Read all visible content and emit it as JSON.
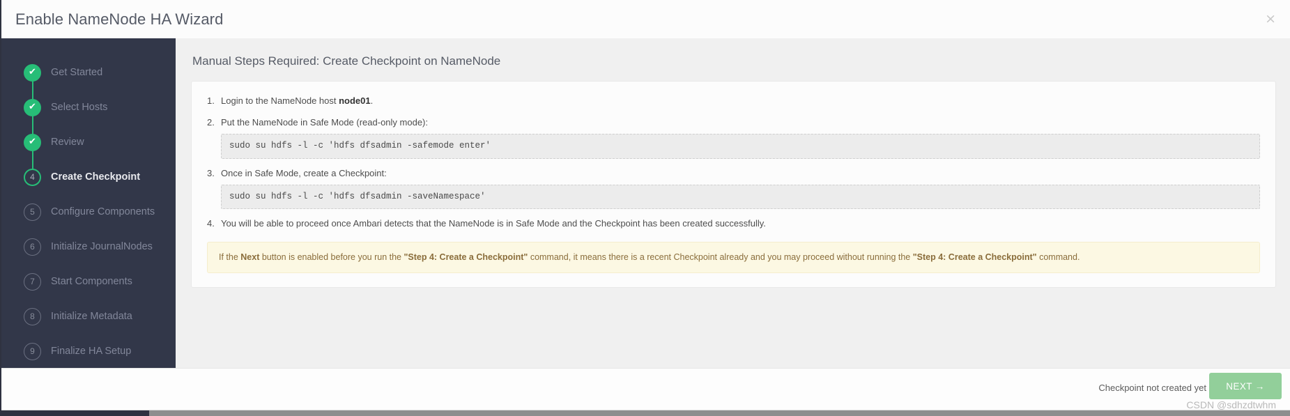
{
  "window": {
    "title": "Enable NameNode HA Wizard",
    "close_icon": "×"
  },
  "sidebar": {
    "steps": [
      {
        "number": "1",
        "label": "Get Started",
        "state": "done",
        "mark": "✔"
      },
      {
        "number": "2",
        "label": "Select Hosts",
        "state": "done",
        "mark": "✔"
      },
      {
        "number": "3",
        "label": "Review",
        "state": "done",
        "mark": "✔"
      },
      {
        "number": "4",
        "label": "Create Checkpoint",
        "state": "current",
        "mark": "4"
      },
      {
        "number": "5",
        "label": "Configure Components",
        "state": "pending",
        "mark": "5"
      },
      {
        "number": "6",
        "label": "Initialize JournalNodes",
        "state": "pending",
        "mark": "6"
      },
      {
        "number": "7",
        "label": "Start Components",
        "state": "pending",
        "mark": "7"
      },
      {
        "number": "8",
        "label": "Initialize Metadata",
        "state": "pending",
        "mark": "8"
      },
      {
        "number": "9",
        "label": "Finalize HA Setup",
        "state": "pending",
        "mark": "9"
      }
    ]
  },
  "main": {
    "heading": "Manual Steps Required: Create Checkpoint on NameNode",
    "items": [
      {
        "text_before": "Login to the NameNode host ",
        "bold": "node01",
        "text_after": ".",
        "code": ""
      },
      {
        "text_before": "Put the NameNode in Safe Mode (read-only mode):",
        "bold": "",
        "text_after": "",
        "code": "sudo su hdfs -l -c 'hdfs dfsadmin -safemode enter'"
      },
      {
        "text_before": "Once in Safe Mode, create a Checkpoint:",
        "bold": "",
        "text_after": "",
        "code": "sudo su hdfs -l -c 'hdfs dfsadmin -saveNamespace'"
      },
      {
        "text_before": "You will be able to proceed once Ambari detects that the NameNode is in Safe Mode and the Checkpoint has been created successfully.",
        "bold": "",
        "text_after": "",
        "code": ""
      }
    ],
    "warning": {
      "part1": "If the ",
      "bold1": "Next",
      "part2": " button is enabled before you run the ",
      "bold2": "\"Step 4: Create a Checkpoint\"",
      "part3": " command, it means there is a recent Checkpoint already and you may proceed without running the ",
      "bold3": "\"Step 4: Create a Checkpoint\"",
      "part4": " command."
    }
  },
  "footer": {
    "note": "Checkpoint not created yet",
    "next_label": "NEXT →",
    "watermark": "CSDN @sdhzdtwhm"
  },
  "colors": {
    "sidebar_bg": "#323749",
    "accent_green": "#27bd77",
    "next_button": "#92cf9a",
    "warning_bg": "#fcf8e3",
    "warning_text": "#8a6d3b"
  }
}
